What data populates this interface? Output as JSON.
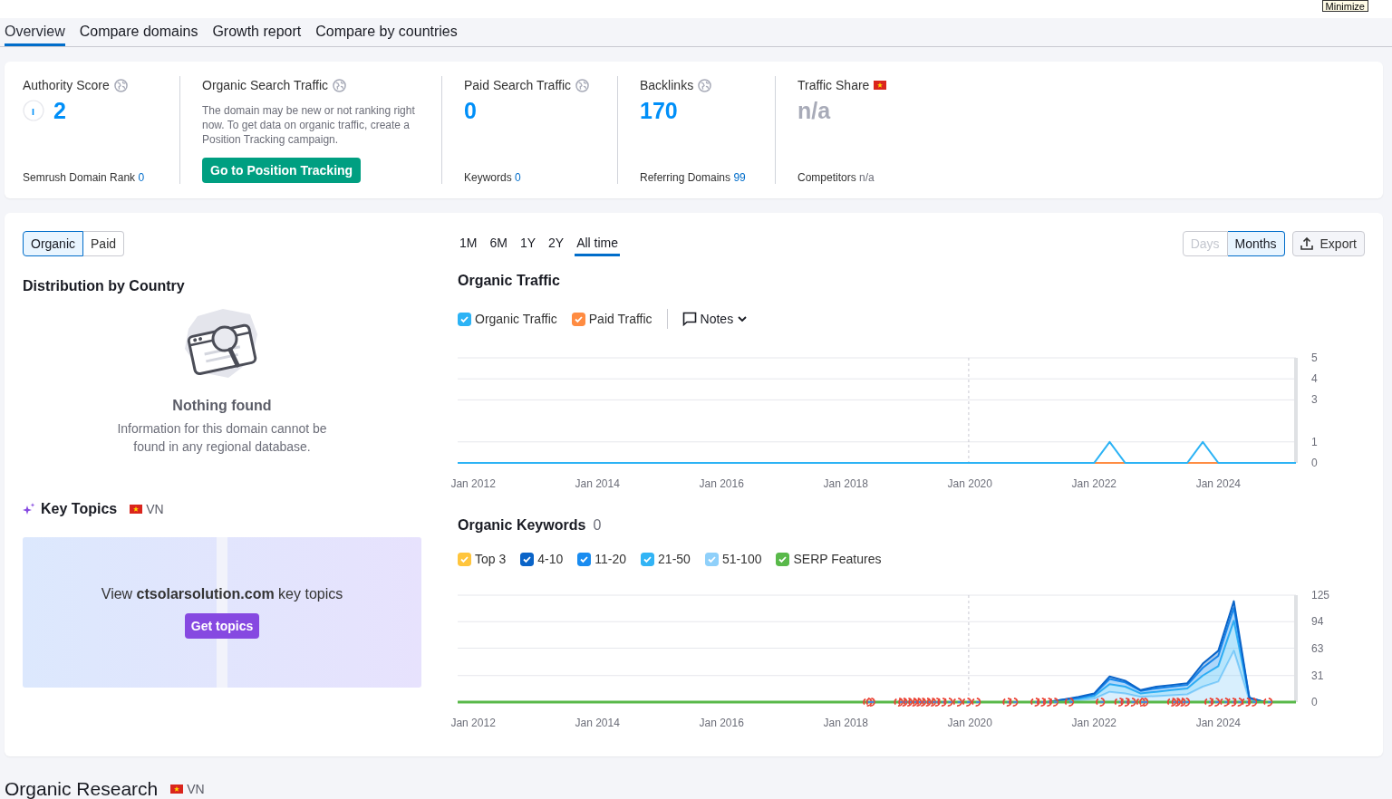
{
  "top_bar": {
    "minimize_button": "Minimize"
  },
  "tabs": [
    {
      "label": "Overview",
      "selected": true
    },
    {
      "label": "Compare domains",
      "selected": false
    },
    {
      "label": "Growth report",
      "selected": false
    },
    {
      "label": "Compare by countries",
      "selected": false
    }
  ],
  "metrics": [
    {
      "kind": "authority",
      "title": "Authority Score",
      "value": "2",
      "footer_label": "Semrush Domain Rank",
      "footer_value": "0"
    },
    {
      "kind": "notice",
      "title": "Organic Search Traffic",
      "description": "The domain may be new or not ranking right now. To get data on organic traffic, create a Position Tracking campaign.",
      "button": "Go to Position Tracking"
    },
    {
      "kind": "number",
      "title": "Paid Search Traffic",
      "value": "0",
      "footer_label": "Keywords",
      "footer_value": "0"
    },
    {
      "kind": "number",
      "title": "Backlinks",
      "value": "170",
      "footer_label": "Referring Domains",
      "footer_value": "99"
    },
    {
      "kind": "country",
      "title": "Traffic Share",
      "value": "n/a",
      "footer_label": "Competitors",
      "footer_value": "n/a"
    }
  ],
  "overview": {
    "segments": [
      {
        "label": "Organic",
        "selected": true
      },
      {
        "label": "Paid",
        "selected": false
      }
    ],
    "distribution": {
      "title": "Distribution by Country",
      "empty_title": "Nothing found",
      "empty_text": "Information for this domain cannot be found in any regional database."
    },
    "key_topics": {
      "title": "Key Topics",
      "country": "VN",
      "prompt": "View **ctsolarsolution.com** key topics",
      "button": "Get topics"
    },
    "periods": [
      {
        "label": "1M",
        "selected": false
      },
      {
        "label": "6M",
        "selected": false
      },
      {
        "label": "1Y",
        "selected": false
      },
      {
        "label": "2Y",
        "selected": false
      },
      {
        "label": "All time",
        "selected": true
      }
    ],
    "granularity": [
      {
        "label": "Days",
        "selected": false,
        "disabled": true
      },
      {
        "label": "Months",
        "selected": true,
        "disabled": false
      }
    ],
    "export_button": "Export",
    "traffic": {
      "title": "Organic Traffic",
      "notes_button": "Notes",
      "legend": [
        {
          "checked": true
        },
        {
          "checked": true
        }
      ],
      "chart_data": {
        "type": "line",
        "categories": [
          null,
          "Jan 2012",
          null,
          null,
          null,
          null,
          null,
          null,
          null,
          "Jan 2014",
          null,
          null,
          null,
          null,
          null,
          null,
          null,
          "Jan 2016",
          null,
          null,
          null,
          null,
          null,
          null,
          null,
          "Jan 2018",
          null,
          null,
          null,
          null,
          null,
          null,
          null,
          "Jan 2020",
          null,
          null,
          null,
          null,
          null,
          null,
          null,
          "Jan 2022",
          null,
          null,
          null,
          null,
          null,
          null,
          null,
          "Jan 2024",
          null,
          null,
          null,
          null,
          null
        ],
        "ylim": [
          0,
          5
        ],
        "yticks": [
          0,
          1,
          3,
          4,
          5
        ],
        "grid": true,
        "series": [
          {
            "name": "Organic Traffic",
            "color": "#2cb3f5",
            "values": [
              0,
              0,
              0,
              0,
              0,
              0,
              0,
              0,
              0,
              0,
              0,
              0,
              0,
              0,
              0,
              0,
              0,
              0,
              0,
              0,
              0,
              0,
              0,
              0,
              0,
              0,
              0,
              0,
              0,
              0,
              0,
              0,
              0,
              0,
              0,
              0,
              0,
              0,
              0,
              0,
              0,
              0,
              1,
              0,
              0,
              0,
              0,
              0,
              1,
              0,
              0,
              0,
              0,
              0,
              0
            ]
          },
          {
            "name": "Paid Traffic",
            "color": "#ff8c42",
            "values": [
              null,
              null,
              null,
              null,
              null,
              null,
              null,
              null,
              null,
              null,
              null,
              null,
              null,
              null,
              null,
              null,
              null,
              null,
              null,
              null,
              null,
              null,
              null,
              null,
              null,
              null,
              null,
              null,
              null,
              null,
              null,
              null,
              null,
              null,
              null,
              null,
              null,
              null,
              null,
              null,
              null,
              0,
              0,
              0,
              null,
              null,
              null,
              0,
              0,
              0,
              null,
              null,
              null,
              null,
              null
            ]
          }
        ]
      }
    },
    "keywords": {
      "title": "Organic Keywords",
      "count": "0",
      "serp_features": {
        "label": "SERP Features",
        "checked": true,
        "color": "#59b94a"
      },
      "legend": [
        {
          "checked": true
        },
        {
          "checked": true
        },
        {
          "checked": true
        },
        {
          "checked": true
        },
        {
          "checked": true
        }
      ],
      "chart_data": {
        "type": "area",
        "stacked": true,
        "categories": [
          null,
          "Jan 2012",
          null,
          null,
          null,
          null,
          null,
          null,
          null,
          "Jan 2014",
          null,
          null,
          null,
          null,
          null,
          null,
          null,
          "Jan 2016",
          null,
          null,
          null,
          null,
          null,
          null,
          null,
          "Jan 2018",
          null,
          null,
          null,
          null,
          null,
          null,
          null,
          "Jan 2020",
          null,
          null,
          null,
          null,
          null,
          null,
          null,
          "Jan 2022",
          null,
          null,
          null,
          null,
          null,
          null,
          null,
          "Jan 2024",
          null,
          null,
          null,
          null,
          null
        ],
        "ylim": [
          0,
          125
        ],
        "yticks": [
          0,
          31,
          63,
          94,
          125
        ],
        "grid": true,
        "series": [
          {
            "name": "Top 3",
            "color": "#ffc53d",
            "values": [
              null,
              null,
              null,
              null,
              null,
              null,
              null,
              null,
              null,
              null,
              null,
              null,
              null,
              null,
              null,
              null,
              null,
              null,
              null,
              null,
              null,
              null,
              null,
              null,
              null,
              null,
              null,
              null,
              null,
              null,
              null,
              null,
              null,
              null,
              null,
              null,
              null,
              null,
              null,
              null,
              null,
              null,
              null,
              null,
              null,
              null,
              null,
              null,
              null,
              null,
              null,
              null,
              null,
              null,
              null
            ]
          },
          {
            "name": "4-10",
            "color": "#0a64c8",
            "values": [
              null,
              null,
              null,
              null,
              null,
              null,
              null,
              null,
              null,
              null,
              null,
              null,
              null,
              null,
              null,
              null,
              null,
              null,
              null,
              null,
              null,
              null,
              null,
              null,
              null,
              null,
              null,
              null,
              null,
              null,
              null,
              null,
              null,
              null,
              null,
              null,
              null,
              null,
              0,
              0,
              1,
              1,
              3,
              2,
              1,
              2,
              2,
              2,
              5,
              6,
              8,
              0,
              0,
              null,
              null
            ]
          },
          {
            "name": "11-20",
            "color": "#1a8cf0",
            "values": [
              null,
              null,
              null,
              null,
              null,
              null,
              null,
              null,
              null,
              null,
              null,
              null,
              null,
              null,
              null,
              null,
              null,
              null,
              null,
              null,
              null,
              null,
              null,
              null,
              null,
              null,
              null,
              null,
              null,
              null,
              null,
              null,
              null,
              null,
              null,
              null,
              null,
              null,
              0,
              1,
              1,
              2,
              6,
              5,
              3,
              4,
              4,
              4,
              9,
              12,
              15,
              1,
              0,
              null,
              null
            ]
          },
          {
            "name": "21-50",
            "color": "#32b4f5",
            "values": [
              null,
              null,
              null,
              null,
              null,
              null,
              null,
              null,
              null,
              null,
              null,
              null,
              null,
              null,
              null,
              null,
              null,
              null,
              null,
              null,
              null,
              null,
              null,
              null,
              null,
              null,
              null,
              null,
              null,
              null,
              null,
              null,
              null,
              null,
              null,
              null,
              null,
              null,
              0,
              1,
              2,
              3,
              9,
              8,
              4,
              5,
              6,
              7,
              13,
              18,
              35,
              2,
              0,
              null,
              null
            ]
          },
          {
            "name": "51-100",
            "color": "#8fd0fa",
            "values": [
              null,
              null,
              null,
              null,
              null,
              null,
              null,
              null,
              null,
              null,
              null,
              null,
              null,
              null,
              null,
              null,
              null,
              null,
              null,
              null,
              null,
              null,
              null,
              null,
              null,
              null,
              null,
              null,
              null,
              null,
              null,
              null,
              null,
              null,
              null,
              null,
              null,
              null,
              0,
              1,
              2,
              4,
              12,
              10,
              6,
              7,
              8,
              9,
              18,
              24,
              60,
              2,
              0,
              null,
              null
            ]
          }
        ]
      }
    }
  },
  "organic_research": {
    "title": "Organic Research",
    "country": "VN"
  }
}
